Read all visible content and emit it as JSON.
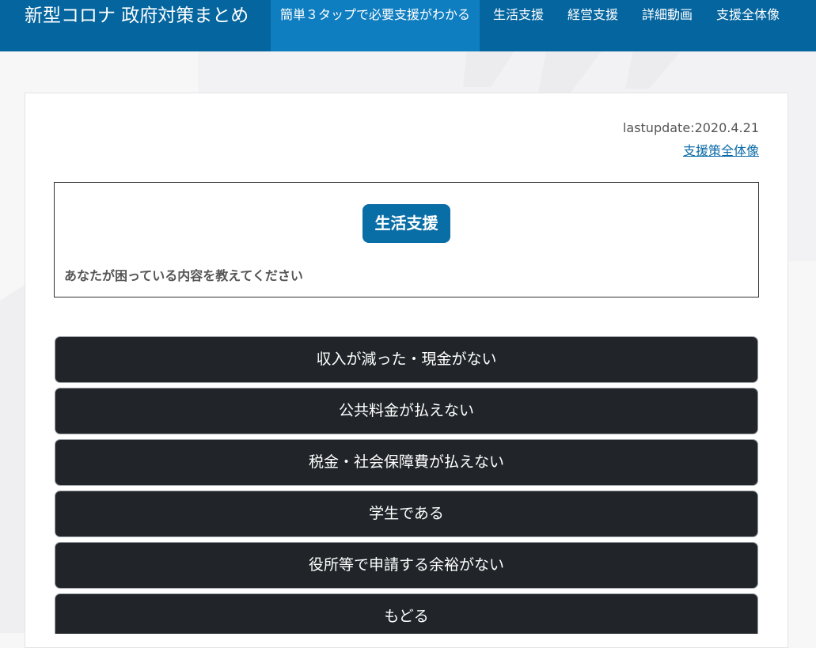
{
  "header": {
    "brand": "新型コロナ 政府対策まとめ",
    "nav": [
      {
        "label": "簡単３タップで必要支援がわかる",
        "active": true
      },
      {
        "label": "生活支援",
        "active": false
      },
      {
        "label": "経営支援",
        "active": false
      },
      {
        "label": "詳細動画",
        "active": false
      },
      {
        "label": "支援全体像",
        "active": false
      }
    ]
  },
  "main": {
    "lastupdate": "lastupdate:2020.4.21",
    "overview_link": "支援策全体像",
    "category": "生活支援",
    "question": "あなたが困っている内容を教えてください",
    "choices": [
      "収入が減った・現金がない",
      "公共料金が払えない",
      "税金・社会保障費が払えない",
      "学生である",
      "役所等で申請する余裕がない",
      "もどる"
    ]
  },
  "colors": {
    "navbar": "#04659f",
    "nav_active": "#0f7ec1",
    "badge": "#0a6ea6",
    "choice_button": "#212529",
    "link": "#0a6aa8"
  }
}
